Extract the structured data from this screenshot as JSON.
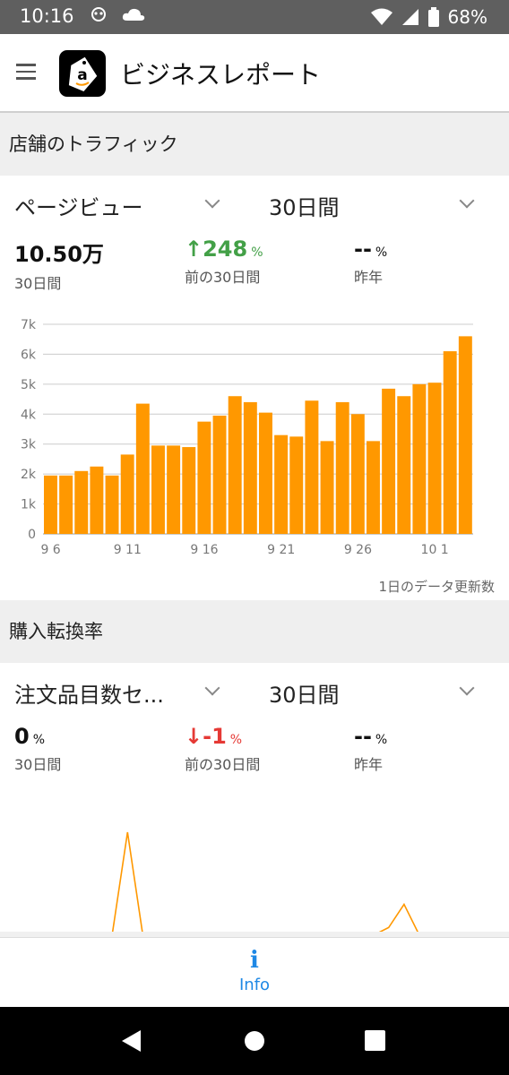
{
  "status_bar": {
    "time": "10:16",
    "battery": "68%"
  },
  "app_bar": {
    "title": "ビジネスレポート",
    "logo_letter": "a"
  },
  "traffic": {
    "section_title": "店舗のトラフィック",
    "metric_dropdown": "ページビュー",
    "period_dropdown": "30日間",
    "current": {
      "value": "10.50万",
      "label": "30日間"
    },
    "prev": {
      "arrow": "↑",
      "value": "248",
      "unit": "%",
      "label": "前の30日間"
    },
    "last_year": {
      "value": "--",
      "unit": "%",
      "label": "昨年"
    },
    "footnote": "1日のデータ更新数"
  },
  "conversion": {
    "section_title": "購入転換率",
    "metric_dropdown": "注文品目数セ...",
    "period_dropdown": "30日間",
    "current": {
      "value": "0",
      "unit": "%",
      "label": "30日間"
    },
    "prev": {
      "arrow": "↓",
      "value": "-1",
      "unit": "%",
      "label": "前の30日間"
    },
    "last_year": {
      "value": "--",
      "unit": "%",
      "label": "昨年"
    }
  },
  "bottom_nav": {
    "info_label": "Info",
    "icon": "info-icon"
  },
  "chart_data": [
    {
      "type": "bar",
      "categories": [
        "9 6",
        "9 7",
        "9 8",
        "9 9",
        "9 10",
        "9 11",
        "9 12",
        "9 13",
        "9 14",
        "9 15",
        "9 16",
        "9 17",
        "9 18",
        "9 19",
        "9 20",
        "9 21",
        "9 22",
        "9 23",
        "9 24",
        "9 25",
        "9 26",
        "9 27",
        "9 28",
        "9 29",
        "9 30",
        "10 1",
        "10 2",
        "10 3"
      ],
      "x_tick_labels": [
        "9 6",
        "9 11",
        "9 16",
        "9 21",
        "9 26",
        "10 1"
      ],
      "values": [
        1950,
        1950,
        2100,
        2250,
        1950,
        2650,
        4350,
        2950,
        2950,
        2900,
        3750,
        3950,
        4600,
        4400,
        4050,
        3300,
        3250,
        4450,
        3100,
        4400,
        4000,
        3100,
        4850,
        4600,
        5000,
        5050,
        6100,
        6600
      ],
      "y_tick_labels": [
        "0",
        "1k",
        "2k",
        "3k",
        "4k",
        "5k",
        "6k",
        "7k"
      ],
      "ylim": [
        0,
        7000
      ],
      "grid": true,
      "color": "#ff9800"
    },
    {
      "type": "line",
      "note": "chart partially visible, y-axis not shown",
      "x": [
        1,
        2,
        3,
        4,
        5,
        6,
        7,
        8,
        9,
        10,
        11,
        12,
        13,
        14,
        15,
        16,
        17,
        18,
        19,
        20,
        21,
        22,
        23,
        24,
        25,
        26,
        27,
        28
      ],
      "values": [
        0,
        0,
        0,
        0,
        0,
        2,
        0,
        0,
        0,
        0,
        0,
        0,
        0,
        0,
        0,
        0,
        0,
        0,
        0,
        0,
        0,
        0,
        0.15,
        0.6,
        0,
        0,
        0,
        0
      ],
      "color": "#ff9800"
    }
  ]
}
